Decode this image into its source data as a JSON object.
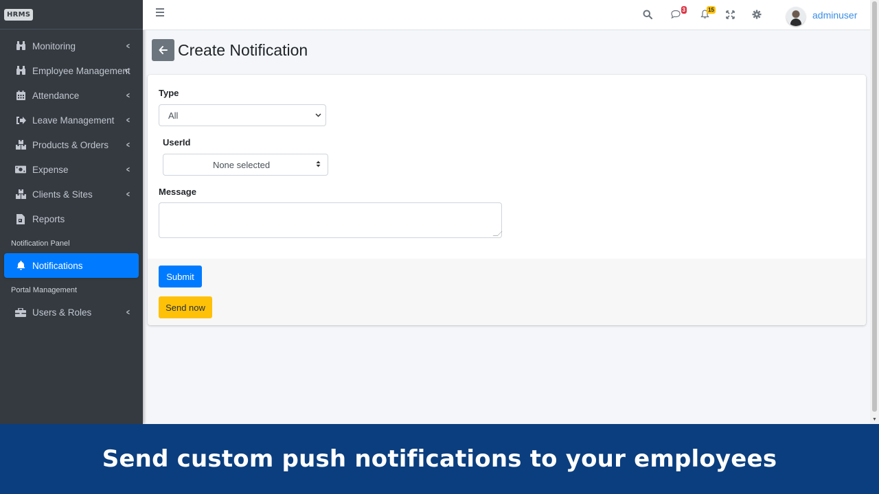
{
  "brand": {
    "logo": "HRMS"
  },
  "sidebar": {
    "items": [
      {
        "icon": "binoculars-icon",
        "glyph": "⛶",
        "label": "Monitoring",
        "chevron": true
      },
      {
        "icon": "binoculars-icon",
        "glyph": "⛶",
        "label": "Employee Management",
        "chevron": true
      },
      {
        "icon": "calendar-icon",
        "glyph": "▦",
        "label": "Attendance",
        "chevron": true
      },
      {
        "icon": "sign-out-icon",
        "glyph": "➜",
        "label": "Leave Management",
        "chevron": true
      },
      {
        "icon": "boxes-icon",
        "glyph": "▞",
        "label": "Products & Orders",
        "chevron": true
      },
      {
        "icon": "money-bill-icon",
        "glyph": "▭",
        "label": "Expense",
        "chevron": true
      },
      {
        "icon": "boxes-icon",
        "glyph": "▞",
        "label": "Clients & Sites",
        "chevron": true
      },
      {
        "icon": "file-pdf-icon",
        "glyph": "▤",
        "label": "Reports",
        "chevron": false
      }
    ],
    "header_notification": "Notification Panel",
    "active_item": {
      "icon": "bell-icon",
      "label": "Notifications"
    },
    "header_portal": "Portal Management",
    "users_item": {
      "icon": "users-cog-icon",
      "label": "Users & Roles"
    }
  },
  "topbar": {
    "messages_badge": "3",
    "notifications_badge": "15",
    "username": "adminuser"
  },
  "page": {
    "title": "Create Notification"
  },
  "form": {
    "type_label": "Type",
    "type_value": "All",
    "userid_label": "UserId",
    "userid_value": "None selected",
    "message_label": "Message",
    "message_value": ""
  },
  "buttons": {
    "submit": "Submit",
    "send_now": "Send now"
  },
  "banner": {
    "text": "Send custom push notifications to your employees"
  },
  "colors": {
    "sidebar_bg": "#343a40",
    "primary": "#007bff",
    "warning": "#ffc107",
    "banner_bg": "#0b3e7e"
  }
}
